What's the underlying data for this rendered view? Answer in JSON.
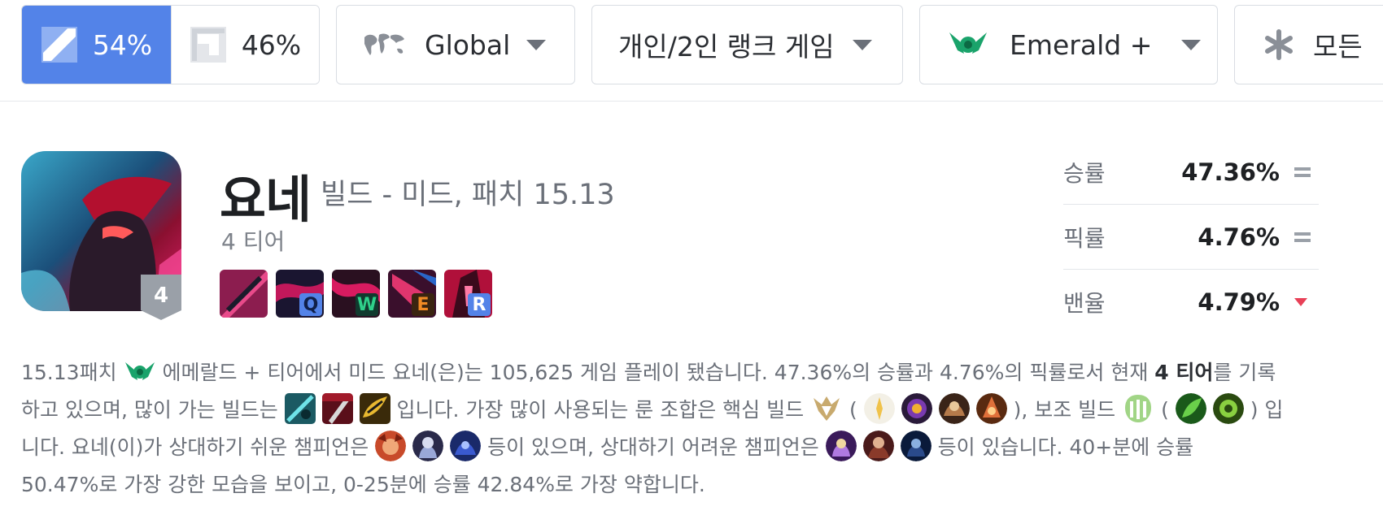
{
  "filters": {
    "side_blue_pct": "54%",
    "side_red_pct": "46%",
    "region": "Global",
    "queue": "개인/2인 랭크 게임",
    "tier": "Emerald +",
    "role": "모든"
  },
  "champion": {
    "name": "요네",
    "subtitle": "빌드 - 미드, 패치 15.13",
    "tier_text": "4 티어",
    "tier_badge": "4",
    "skills": [
      {
        "name": "passive",
        "key": ""
      },
      {
        "name": "q",
        "key": "Q"
      },
      {
        "name": "w",
        "key": "W"
      },
      {
        "name": "e",
        "key": "E"
      },
      {
        "name": "r",
        "key": "R"
      }
    ]
  },
  "stats": {
    "win_label": "승률",
    "win_value": "47.36%",
    "pick_label": "픽률",
    "pick_value": "4.76%",
    "ban_label": "밴율",
    "ban_value": "4.79%"
  },
  "description": {
    "l1a": "15.13패치 ",
    "l1b": " 에메랄드 + 티어에서 미드 요네(은)는 105,625 게임 플레이 됐습니다. 47.36%의 승률과 4.76%의 픽률로서 현재 ",
    "l1bold": "4 티어",
    "l1c": "를 기록",
    "l2a": "하고 있으며, 많이 가는 빌드는 ",
    "l2b": "입니다. 가장 많이 사용되는 룬 조합은 핵심 빌드 ",
    "l2c": " (",
    "l2d": "), 보조 빌드 ",
    "l2e": " (",
    "l2f": ") 입",
    "l3a": "니다. 요네(이)가 상대하기 쉬운 챔피언은 ",
    "l3b": " 등이 있으며, 상대하기 어려운 챔피언은 ",
    "l3c": " 등이 있습니다. 40+분에 승률",
    "l4": "50.47%로 가장 강한 모습을 보이고, 0-25분에 승률 42.84%로 가장 약합니다."
  },
  "colors": {
    "accent_blue": "#5383e8",
    "emerald": "#1aa36b",
    "trend_down": "#e84057"
  }
}
